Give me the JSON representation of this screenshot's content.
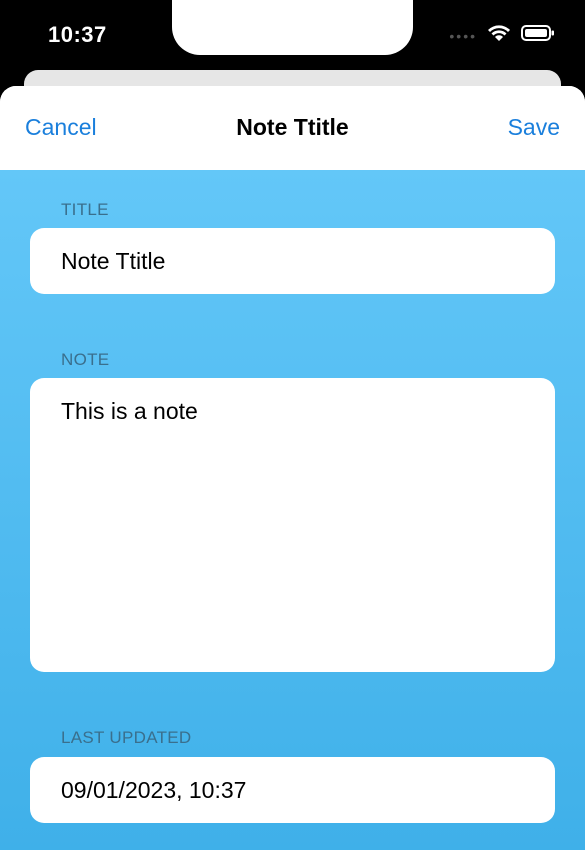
{
  "status_bar": {
    "time": "10:37",
    "icons": [
      "signal-dots-icon",
      "wifi-icon",
      "battery-icon"
    ]
  },
  "nav": {
    "cancel_label": "Cancel",
    "title": "Note Ttitle",
    "save_label": "Save"
  },
  "form": {
    "title_label": "TITLE",
    "title_value": "Note Ttitle",
    "note_label": "NOTE",
    "note_value": "This is a note",
    "last_updated_label": "LAST UPDATED",
    "last_updated_value": "09/01/2023, 10:37"
  },
  "colors": {
    "accent": "#1a7fdc",
    "background_top": "#63c7f8",
    "background_bottom": "#3fb0e9"
  }
}
